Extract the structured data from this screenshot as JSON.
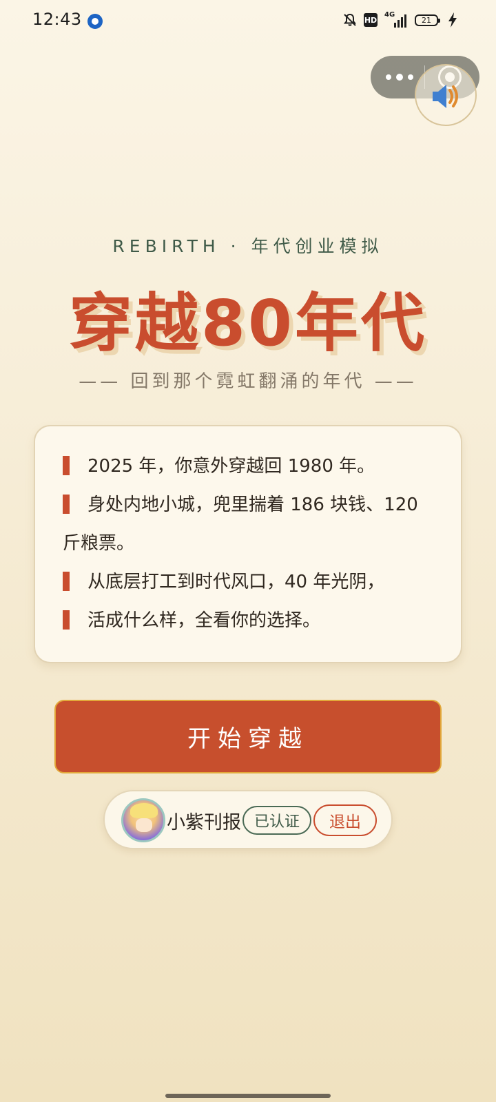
{
  "status_bar": {
    "time": "12:43",
    "network": "4G",
    "hd": "HD",
    "battery": "21",
    "icons": [
      "app-notification-icon",
      "bell-muted-icon",
      "hd-icon",
      "signal-icon",
      "battery-icon",
      "charging-icon"
    ]
  },
  "capsule": {
    "icons": [
      "more-icon",
      "close-target-icon"
    ]
  },
  "sound": {
    "icon": "speaker-icon",
    "colors": {
      "speaker": "#3f7fd0",
      "waves": "#e08a2e"
    }
  },
  "header": {
    "eyebrow": "REBIRTH · 年代创业模拟",
    "title": "穿越80年代",
    "tagline": "—— 回到那个霓虹翻涌的年代 ——"
  },
  "intro": {
    "lines": [
      "2025 年，你意外穿越回 1980 年。",
      "身处内地小城，兜里揣着 186 块钱、120 斤粮票。",
      "从底层打工到时代风口，40 年光阴，",
      "活成什么样，全看你的选择。"
    ]
  },
  "start_button": {
    "label": "开始穿越"
  },
  "user": {
    "name": "小紫刊报",
    "verified_label": "已认证",
    "logout_label": "退出"
  },
  "colors": {
    "accent": "#c94d2e",
    "green": "#3f5a48",
    "background": "#f6ecd5"
  }
}
